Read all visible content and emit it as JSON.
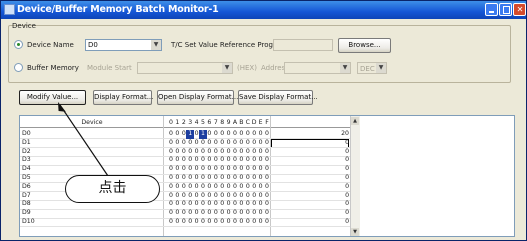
{
  "window": {
    "title": "Device/Buffer Memory Batch Monitor-1"
  },
  "device_group": {
    "label": "Device",
    "device_name_radio": "Device Name",
    "device_name_value": "D0",
    "tc_label": "T/C Set Value Reference Program",
    "browse_label": "Browse...",
    "buffer_memory_radio": "Buffer Memory",
    "module_start_label": "Module Start",
    "address_label": "Address",
    "dec_label": "DEC",
    "hex_label": "(HEX)"
  },
  "toolbar": {
    "modify_value": "Modify Value...",
    "display_format": "Display Format...",
    "open_display_format": "Open Display Format...",
    "save_display_format": "Save Display Format..."
  },
  "monitor": {
    "device_header": "Device",
    "bit_headers": [
      "0",
      "1",
      "2",
      "3",
      "4",
      "5",
      "6",
      "7",
      "8",
      "9",
      "A",
      "B",
      "C",
      "D",
      "E",
      "F"
    ],
    "rows": [
      {
        "device": "D0",
        "bits": [
          0,
          0,
          0,
          1,
          0,
          1,
          0,
          0,
          0,
          0,
          0,
          0,
          0,
          0,
          0,
          0
        ],
        "value": "20"
      },
      {
        "device": "D1",
        "bits": [
          0,
          0,
          0,
          0,
          0,
          0,
          0,
          0,
          0,
          0,
          0,
          0,
          0,
          0,
          0,
          0
        ],
        "value": "0"
      },
      {
        "device": "D2",
        "bits": [
          0,
          0,
          0,
          0,
          0,
          0,
          0,
          0,
          0,
          0,
          0,
          0,
          0,
          0,
          0,
          0
        ],
        "value": "0"
      },
      {
        "device": "D3",
        "bits": [
          0,
          0,
          0,
          0,
          0,
          0,
          0,
          0,
          0,
          0,
          0,
          0,
          0,
          0,
          0,
          0
        ],
        "value": "0"
      },
      {
        "device": "D4",
        "bits": [
          0,
          0,
          0,
          0,
          0,
          0,
          0,
          0,
          0,
          0,
          0,
          0,
          0,
          0,
          0,
          0
        ],
        "value": "0"
      },
      {
        "device": "D5",
        "bits": [
          0,
          0,
          0,
          0,
          0,
          0,
          0,
          0,
          0,
          0,
          0,
          0,
          0,
          0,
          0,
          0
        ],
        "value": "0"
      },
      {
        "device": "D6",
        "bits": [
          0,
          0,
          0,
          0,
          0,
          0,
          0,
          0,
          0,
          0,
          0,
          0,
          0,
          0,
          0,
          0
        ],
        "value": "0"
      },
      {
        "device": "D7",
        "bits": [
          0,
          0,
          0,
          0,
          0,
          0,
          0,
          0,
          0,
          0,
          0,
          0,
          0,
          0,
          0,
          0
        ],
        "value": "0"
      },
      {
        "device": "D8",
        "bits": [
          0,
          0,
          0,
          0,
          0,
          0,
          0,
          0,
          0,
          0,
          0,
          0,
          0,
          0,
          0,
          0
        ],
        "value": "0"
      },
      {
        "device": "D9",
        "bits": [
          0,
          0,
          0,
          0,
          0,
          0,
          0,
          0,
          0,
          0,
          0,
          0,
          0,
          0,
          0,
          0
        ],
        "value": "0"
      },
      {
        "device": "D10",
        "bits": [
          0,
          0,
          0,
          0,
          0,
          0,
          0,
          0,
          0,
          0,
          0,
          0,
          0,
          0,
          0,
          0
        ],
        "value": "0"
      }
    ]
  },
  "callout": {
    "text": "点击"
  }
}
